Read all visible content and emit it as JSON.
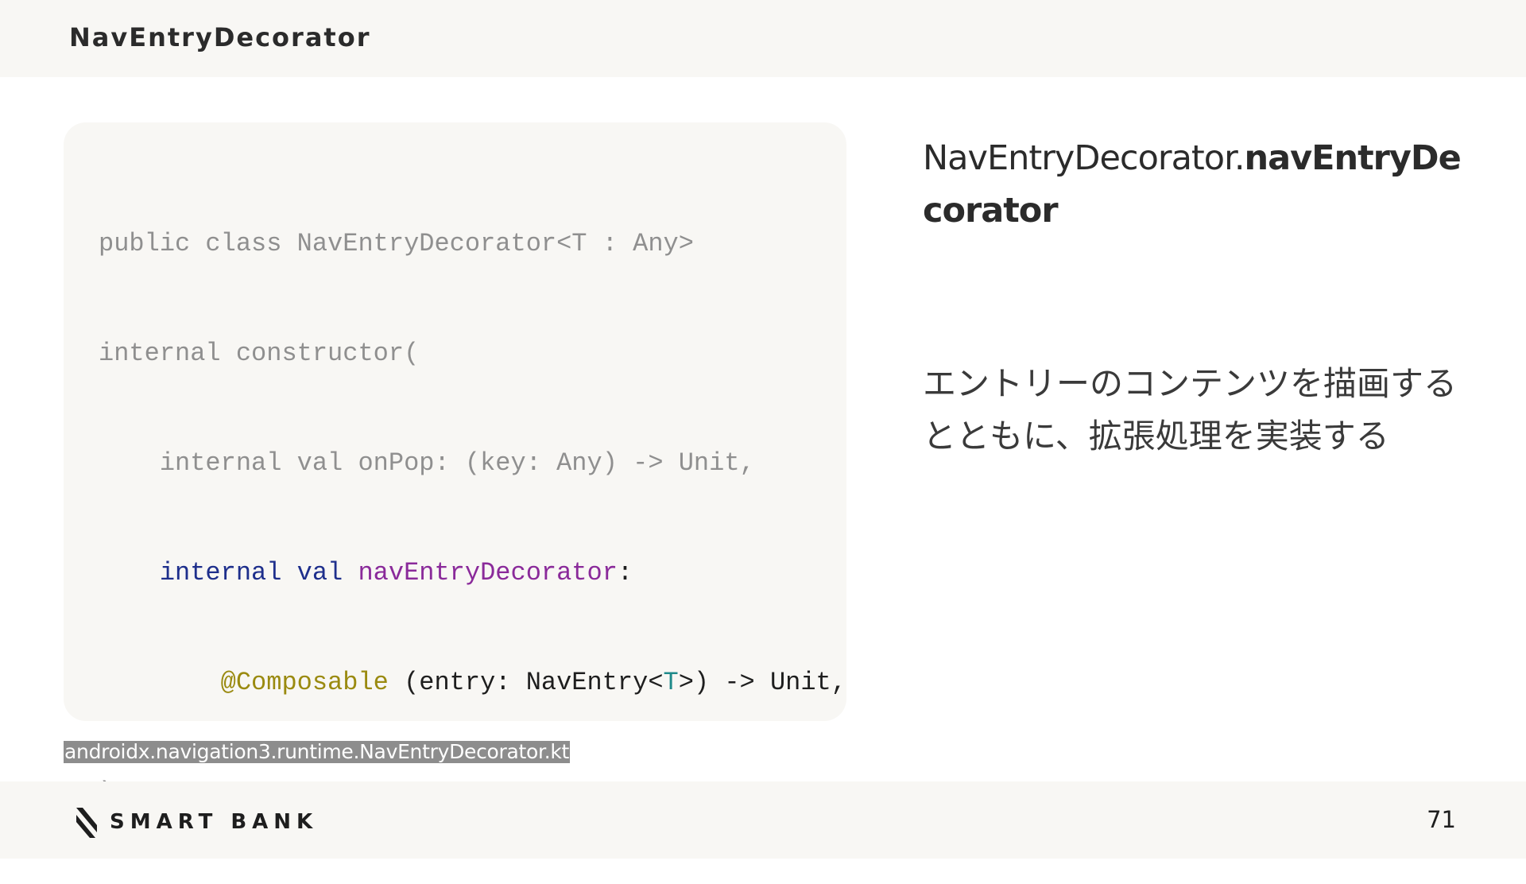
{
  "header": {
    "title": "NavEntryDecorator"
  },
  "code": {
    "lines": [
      {
        "indent": "",
        "text": "public class NavEntryDecorator<T : Any>"
      },
      {
        "indent": "",
        "text": "internal constructor("
      },
      {
        "indent": "    ",
        "text": "internal val onPop: (key: Any) -> Unit,"
      },
      {
        "indent": "    ",
        "kw": "internal val",
        "prop": "navEntryDecorator",
        "rest": ":"
      },
      {
        "indent": "        ",
        "ann": "@Composable",
        "pre": " (entry: NavEntry<",
        "typ": "T",
        "post": ">) -> Unit,"
      },
      {
        "indent": "",
        "text": ")"
      }
    ]
  },
  "source": {
    "label": "androidx.navigation3.runtime.NavEntryDecorator.kt"
  },
  "right": {
    "title_normal": "NavEntryDecorator.",
    "title_bold": "navEntryDecorator",
    "description": "エントリーのコンテンツを描画するとともに、拡張処理を実装する"
  },
  "footer": {
    "logo_text": "SMART BANK",
    "logo_icon": "smartbank-logo-icon",
    "page_number": "71"
  },
  "colors": {
    "keyword": "#1e2f8c",
    "property": "#8a2a9a",
    "annotation": "#9a8a10",
    "type_param": "#1f8a8a",
    "dimmed_code": "#8f8f8f",
    "panel_background": "#f8f7f4"
  }
}
